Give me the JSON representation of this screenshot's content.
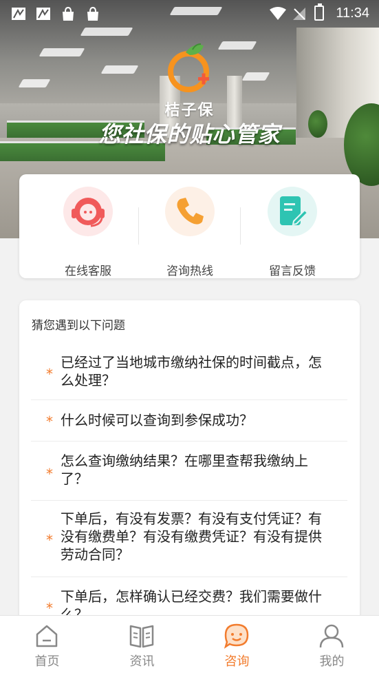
{
  "status_bar": {
    "time": "11:34",
    "icons": [
      "notification-icon",
      "notification-icon",
      "shopping-bag-icon",
      "shopping-bag-icon",
      "wifi-icon",
      "no-signal-icon",
      "battery-charging-icon"
    ]
  },
  "banner": {
    "brand_name": "桔子保",
    "slogan": "您社保的贴心管家",
    "accent_color": "#f7931e"
  },
  "services": [
    {
      "label": "在线客服",
      "icon": "headset-icon",
      "color": "#f05a5a"
    },
    {
      "label": "咨询热线",
      "icon": "phone-icon",
      "color": "#f5a033"
    },
    {
      "label": "留言反馈",
      "icon": "edit-note-icon",
      "color": "#2ec4b2"
    }
  ],
  "faq": {
    "title": "猜您遇到以下问题",
    "items": [
      {
        "text": "已经过了当地城市缴纳社保的时间截点，怎么处理？"
      },
      {
        "text": "什么时候可以查询到参保成功？"
      },
      {
        "text": "怎么查询缴纳结果？在哪里查帮我缴纳上了？"
      },
      {
        "text": "下单后，有没有发票？有没有支付凭证？有没有缴费单？有没有缴费凭证？有没有提供劳动合同？"
      },
      {
        "text": "下单后，怎样确认已经交费？我们需要做什么？"
      }
    ],
    "star": "*"
  },
  "bottom_nav": {
    "items": [
      {
        "label": "首页",
        "icon": "home-icon",
        "active": false
      },
      {
        "label": "资讯",
        "icon": "book-icon",
        "active": false
      },
      {
        "label": "咨询",
        "icon": "chat-icon",
        "active": true
      },
      {
        "label": "我的",
        "icon": "user-icon",
        "active": false
      }
    ],
    "active_color": "#f27c2e",
    "inactive_color": "#888888"
  }
}
